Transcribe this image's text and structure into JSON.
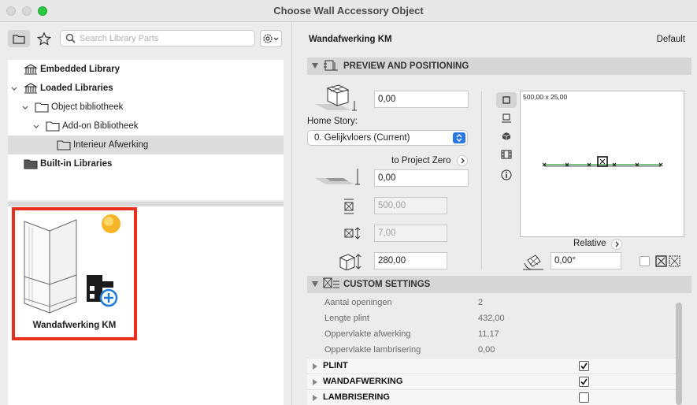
{
  "window": {
    "title": "Choose Wall Accessory Object"
  },
  "left": {
    "search_placeholder": "Search Library Parts",
    "tree": [
      {
        "label": "Embedded Library",
        "bold": true
      },
      {
        "label": "Loaded Libraries",
        "bold": true
      },
      {
        "label": "Object bibliotheek",
        "bold": false
      },
      {
        "label": "Add-on Bibliotheek",
        "bold": false
      },
      {
        "label": "Interieur Afwerking",
        "bold": false,
        "selected": true
      },
      {
        "label": "Built-in Libraries",
        "bold": true
      }
    ],
    "gallery_item": {
      "label": "Wandafwerking KM",
      "highlight_color": "#e8311c"
    }
  },
  "right": {
    "object_name": "Wandafwerking KM",
    "default_label": "Default",
    "preview_section": {
      "title": "PREVIEW AND POSITIONING",
      "elevation_value": "0,00",
      "home_story_label": "Home Story:",
      "home_story_value": "0. Gelijkvloers (Current)",
      "to_project_zero_label": "to Project Zero",
      "project_zero_value": "0,00",
      "dim_a_value": "500,00",
      "dim_b_value": "7,00",
      "height_value": "280,00",
      "preview_dimensions": "500,00 x 25,00",
      "relative_label": "Relative",
      "angle_value": "0,00°"
    },
    "custom_section": {
      "title": "CUSTOM SETTINGS",
      "rows": [
        {
          "key": "Aantal openingen",
          "value": "2"
        },
        {
          "key": "Lengte plint",
          "value": "432,00"
        },
        {
          "key": "Oppervlakte afwerking",
          "value": "11,17"
        },
        {
          "key": "Oppervlakte lambrisering",
          "value": "0,00"
        }
      ],
      "groups": [
        {
          "key": "PLINT",
          "checked": true
        },
        {
          "key": "WANDAFWERKING",
          "checked": true
        },
        {
          "key": "LAMBRISERING",
          "checked": false
        }
      ]
    }
  }
}
